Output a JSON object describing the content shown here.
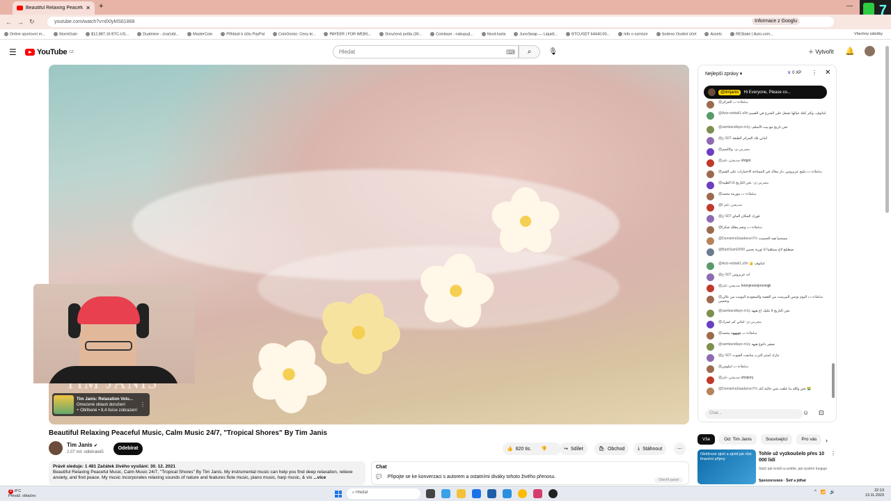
{
  "browser": {
    "tab_title": "Beautiful Relaxing Peaceful Mu...",
    "url": "youtube.com/watch?v=dXlyMS61868",
    "google_info": "Informace z Googlu",
    "bookmarks": [
      "Online sportovní m...",
      "StormGain",
      "$12,887.16 BTC-US...",
      "Dualmine - značobt...",
      "MasterCoin",
      "Přihlásit k účtu PayPal",
      "CoinGecko: Ceny kr...",
      "PAYEER | FOR WEBS...",
      "Doručená pošta (30...",
      "Coinbase - nakupujt...",
      "Nová karta",
      "JunoSwap — Liquidi...",
      "BTCUSDT 64440.00...",
      "Info o osmóze",
      "Sodexo Osobní účet",
      "Assets",
      "RESlake | Auto-com..."
    ],
    "all_bookmarks": "Všechny záložky"
  },
  "yt": {
    "logo": "YouTube",
    "logo_country": "CZ",
    "search_placeholder": "Hledat",
    "create": "Vytvořit"
  },
  "player": {
    "watermark": "TIM JANIS",
    "mini_title": "Tim Janis: Relaxation Volu...",
    "mini_line2": "Omezené oblasti doručení",
    "mini_line3": "+ Oblíbené • 8,4 tisíce zobrazení"
  },
  "video": {
    "title": "Beautiful Relaxing Peaceful Music, Calm Music 24/7, \"Tropical Shores\" By Tim Janis",
    "channel": "Tim Janis",
    "subs": "2,07 mil. odběratelů",
    "subscribe": "Odebírat",
    "likes": "820 tis.",
    "share": "Sdílet",
    "shop": "Obchod",
    "download": "Stáhnout",
    "desc_stats": "Právě sleduje: 1 481  Začátek živého vysílání: 30. 12. 2021",
    "desc_text": "Beautiful Relaxing Peaceful Music, Calm Music 24/7, \"Tropical Shores\" By Tim Janis.  My instrumental music can help you find deep relaxation, relieve anxiety, and find peace. My music incorporates relaxing sounds of nature and features flute music, piano music, harp music, & vio",
    "more": "...více"
  },
  "chat_bar": {
    "label": "Chat",
    "text": "Připojte se ke konverzaci s autorem a ostatními diváky tohoto živého přenosu.",
    "open": "Otevřít panel"
  },
  "live_chat": {
    "mode": "Nejlepší zprávy",
    "xp": "0 XP",
    "pinned_name": "@timjanis",
    "pinned_text": "Hi Everyone, Please co...",
    "input_placeholder": "Chat...",
    "messages": [
      {
        "who": "@سلطانة-ت",
        "text": "الجزائر",
        "color": "#9c6b4e"
      },
      {
        "who": "@Aziz-widadi1.u9n",
        "text": "امانوف، وكثر كتلة حيالها تشغل على الشرح في القسم",
        "color": "#5a9a6a",
        "tall": true
      },
      {
        "who": "@sambandlaye-m1y",
        "text": "نحن تاريخ مع بيت الأسلف",
        "color": "#7c8f4e"
      },
      {
        "who": "@ع-S07",
        "text": "أماني بلاد الجزائر الطبقة",
        "color": "#8e6bb0"
      },
      {
        "who": "@مصرس-ى-",
        "text": "وكالسم",
        "color": "#6a3fc2"
      },
      {
        "who": "@صديقتي-علم",
        "text": "ohqpò",
        "color": "#c0392b"
      },
      {
        "who": "@سلطانة-ت",
        "text": "مليح عزيزوس، دار معاك في المساحة الاختبارات على القيم",
        "color": "#9c6b4e"
      },
      {
        "who": "@مصرس-ى-",
        "text": "نحن التاريخ أنا الطيبة",
        "color": "#6a3fc2"
      },
      {
        "who": "@سلطانة-ت",
        "text": "نبورينة محمد",
        "color": "#9c6b4e"
      },
      {
        "who": "@صديقتي-علم",
        "text": "ا",
        "color": "#c0392b"
      },
      {
        "who": "@ع-S07",
        "text": "فورك المكان الماي",
        "color": "#8e6bb0"
      },
      {
        "who": "@سلطانة-ت",
        "text": "ونعم مقلك شكرا",
        "color": "#9c6b4e"
      },
      {
        "who": "@DumaimaSaadaoui-f7o",
        "text": "مسحبيا هيه الحسنت",
        "color": "#b5845a"
      },
      {
        "who": "@BadrSami2000",
        "text": "صطيلح لاغ سبتلقيا انا ثورية بجنبي",
        "color": "#6b7c8f",
        "tall": true
      },
      {
        "who": "@Aziz-widadi1.u9n",
        "text": "👍 امانوف",
        "color": "#5a9a6a"
      },
      {
        "who": "@ع-S07",
        "text": "انه عزيزوس",
        "color": "#8e6bb0"
      },
      {
        "who": "@صديقتي-علم",
        "text": "hmmjmmmjmmmjjk",
        "color": "#c0392b"
      },
      {
        "who": "@سلطانة-ت",
        "text": "اليوم تونس البيرمنت من القصة والسعودية اليومت من عالي وتحسن",
        "color": "#9c6b4e",
        "tall": true
      },
      {
        "who": "@sambandlaye-m1y",
        "text": "نحن التاريخ لا عليك اخ هيهه",
        "color": "#7c8f4e"
      },
      {
        "who": "@مصرس-ى-",
        "text": "اماني كم عمرك",
        "color": "#6a3fc2"
      },
      {
        "who": "@سلطانة-ت",
        "text": "هههههه محمد",
        "color": "#9c6b4e"
      },
      {
        "who": "@sambandlaye-m1y",
        "text": "صقير ذاتوع هيهه",
        "color": "#7c8f4e"
      },
      {
        "who": "@ع-S07",
        "text": "تبارك لمنتز الترب متابعت الصوت",
        "color": "#8e6bb0"
      },
      {
        "who": "@سلطانة-ت",
        "text": "أبيلوس",
        "color": "#9c6b4e"
      },
      {
        "who": "@صديقتي-علم",
        "text": "ohnjionj",
        "color": "#c0392b"
      },
      {
        "who": "@DumaimaSaadaoui-f7o",
        "text": "نحن والله ما علقت شي حالية أنك 😭",
        "color": "#b5845a",
        "tall": true
      }
    ]
  },
  "sidebar": {
    "chips": [
      "Vše",
      "Od: Tim Janis",
      "Související",
      "Pro vás"
    ],
    "rec_thumb": "Obtížnost zjistí a zjistit jak růst finanční příjmy",
    "rec_title": "Tohle už vyzkoušelo přes 10 000 lidí",
    "rec_sub": "Stačí pár kroků a uvidíte, jak systém funguje",
    "rec_sponsor": "Sponzorováno · Šetř a jídhat"
  },
  "taskbar": {
    "temp": "8°C",
    "weather": "Převáž. oblačno",
    "badge": "2",
    "search": "Hledat",
    "time": "22:13",
    "date": "13.11.2023"
  },
  "colors": {
    "yt_red": "#ff0000",
    "pinned_bg": "#0f0f0f",
    "subscribe_bg": "#0f0f0f"
  }
}
